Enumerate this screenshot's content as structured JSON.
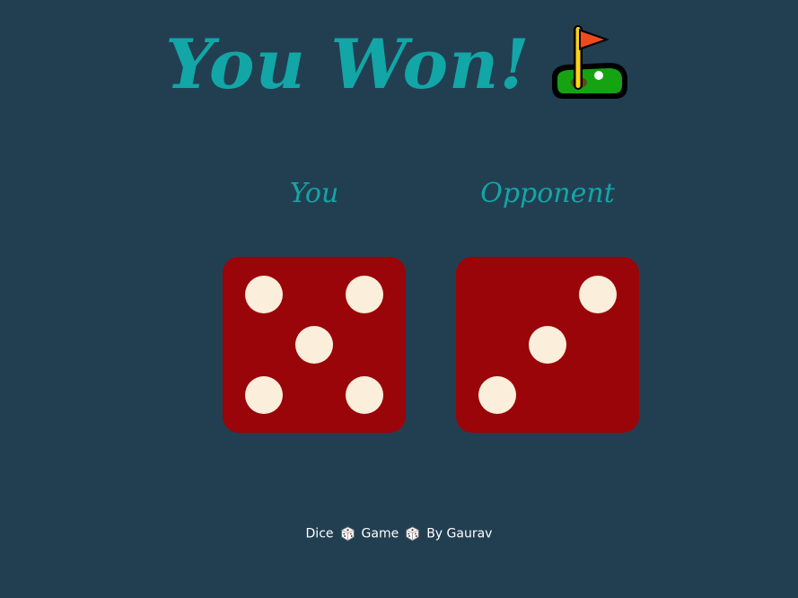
{
  "header": {
    "title": "You Won!",
    "icon": "golf-flag-icon"
  },
  "players": [
    {
      "label": "You",
      "die_value": 5
    },
    {
      "label": "Opponent",
      "die_value": 3
    }
  ],
  "footer": {
    "word1": "Dice",
    "icon1": "die-icon",
    "word2": "Game",
    "icon2": "die-icon",
    "word3": "By Gaurav"
  },
  "colors": {
    "background": "#223f52",
    "accent": "#12a6a6",
    "die_face": "#990509",
    "pip": "#fbeedb"
  }
}
